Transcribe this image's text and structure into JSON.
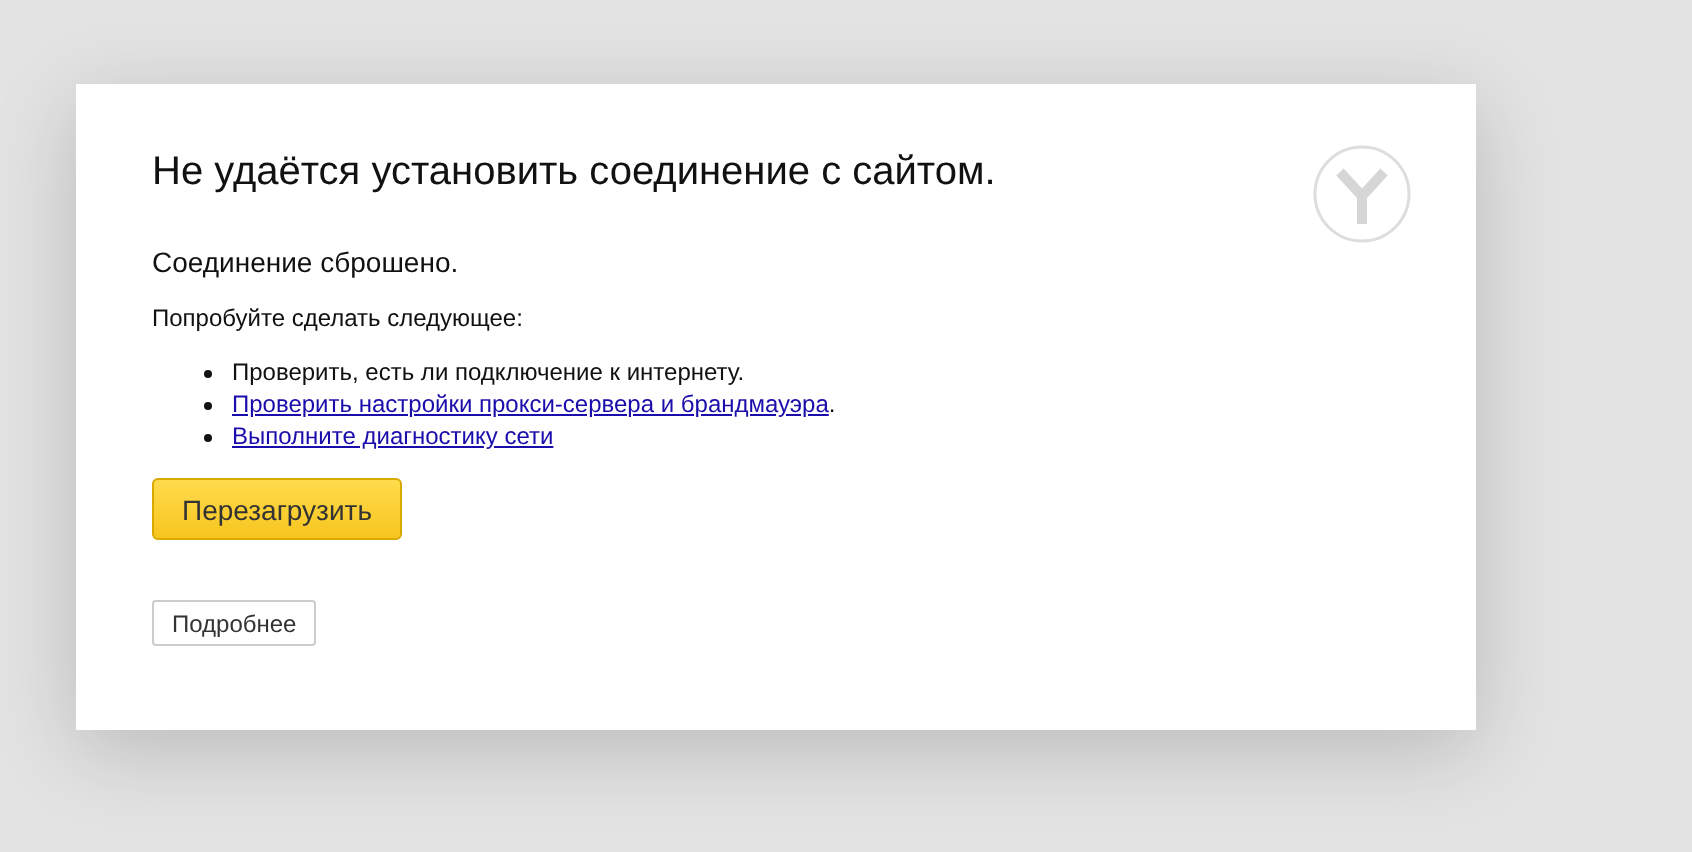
{
  "error": {
    "title": "Не удаётся установить соединение с сайтом.",
    "reason": "Соединение сброшено.",
    "suggestions_intro": "Попробуйте сделать следующее:",
    "suggestions": [
      {
        "kind": "text",
        "text": "Проверить, есть ли подключение к интернету."
      },
      {
        "kind": "link",
        "text": "Проверить настройки прокси-сервера и брандмауэра",
        "suffix": "."
      },
      {
        "kind": "link",
        "text": "Выполните диагностику сети"
      }
    ],
    "buttons": [
      {
        "kind": "primary",
        "label": "Перезагрузить"
      },
      {
        "kind": "secondary",
        "label": "Подробнее"
      }
    ]
  }
}
